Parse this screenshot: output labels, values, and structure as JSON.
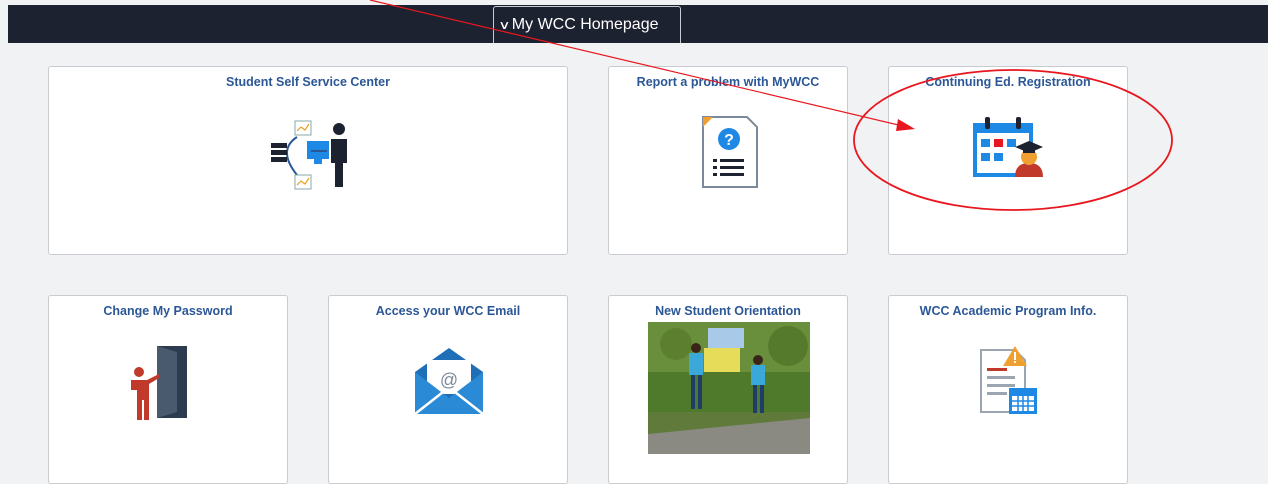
{
  "header": {
    "home_label": "My WCC Homepage",
    "chevron_glyph": "∨"
  },
  "tiles": [
    {
      "title": "Student Self Service Center",
      "icon": "self-service-icon"
    },
    {
      "title": "Report a problem with MyWCC",
      "icon": "report-problem-icon"
    },
    {
      "title": "Continuing Ed. Registration",
      "icon": "calendar-registration-icon"
    },
    {
      "title": "Change My Password",
      "icon": "door-person-icon"
    },
    {
      "title": "Access your WCC Email",
      "icon": "email-envelope-icon"
    },
    {
      "title": "New Student Orientation",
      "icon": "orientation-photo"
    },
    {
      "title": "WCC Academic Program Info.",
      "icon": "program-info-icon"
    }
  ],
  "annotation": {
    "color": "#e8171f"
  }
}
